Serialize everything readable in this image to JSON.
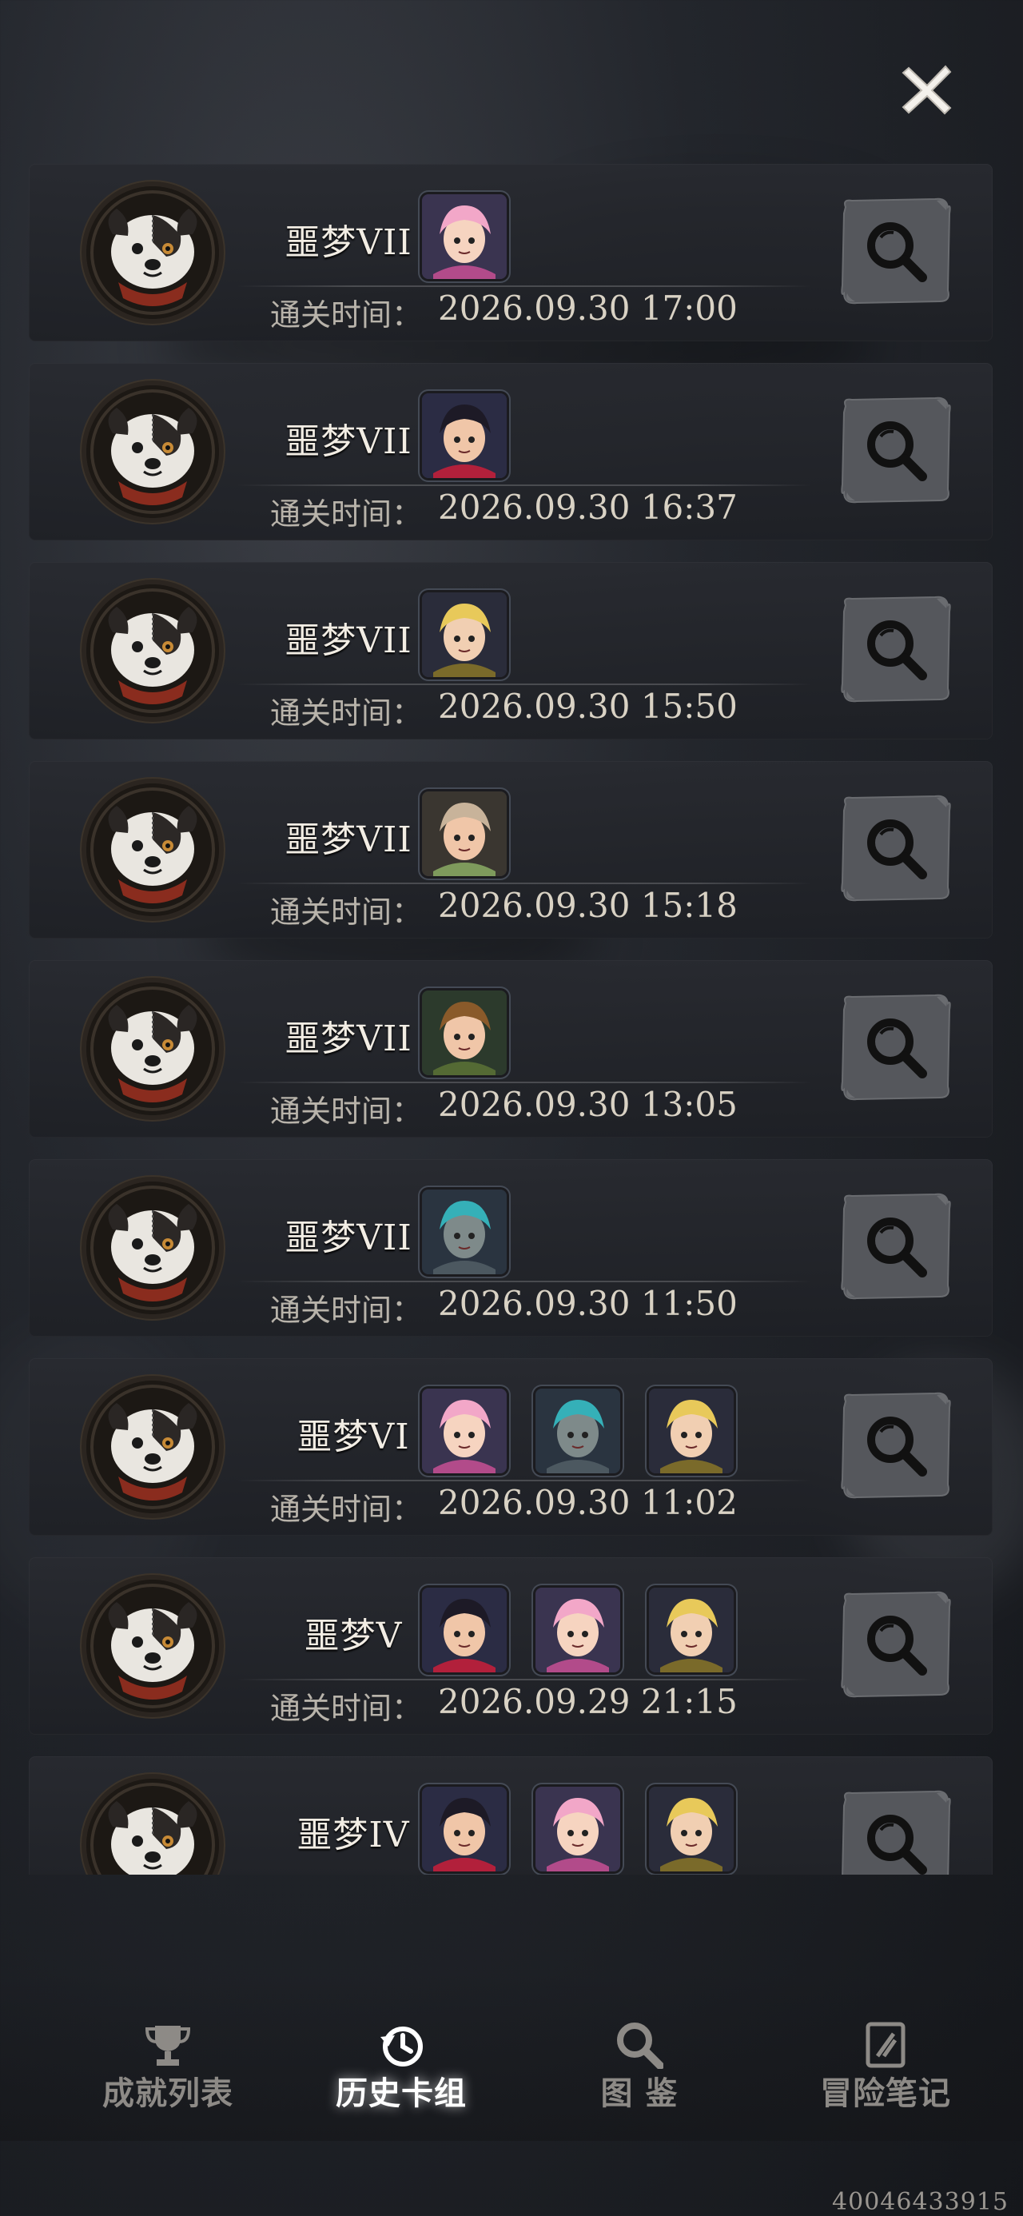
{
  "close_label": "✕",
  "time_label": "通关时间：",
  "records": [
    {
      "stage": "噩梦VII",
      "time": "2026.09.30 17:00",
      "cards": [
        "elf-pink-hair"
      ]
    },
    {
      "stage": "噩梦VII",
      "time": "2026.09.30 16:37",
      "cards": [
        "girl-red-bow"
      ]
    },
    {
      "stage": "噩梦VII",
      "time": "2026.09.30 15:50",
      "cards": [
        "blonde-knight"
      ]
    },
    {
      "stage": "噩梦VII",
      "time": "2026.09.30 15:18",
      "cards": [
        "bear-ears-girl"
      ]
    },
    {
      "stage": "噩梦VII",
      "time": "2026.09.30 13:05",
      "cards": [
        "green-hat-boy"
      ]
    },
    {
      "stage": "噩梦VII",
      "time": "2026.09.30 11:50",
      "cards": [
        "robot-mohawk"
      ]
    },
    {
      "stage": "噩梦VI",
      "time": "2026.09.30 11:02",
      "cards": [
        "elf-pink-hair",
        "robot-mohawk",
        "blonde-knight"
      ]
    },
    {
      "stage": "噩梦V",
      "time": "2026.09.29 21:15",
      "cards": [
        "girl-red-bow",
        "elf-pink-hair",
        "blonde-knight"
      ]
    },
    {
      "stage": "噩梦IV",
      "time": "",
      "cards": [
        "girl-red-bow",
        "elf-pink-hair",
        "blonde-knight"
      ]
    }
  ],
  "tabs": [
    {
      "label": "成就列表",
      "icon": "trophy-icon",
      "active": false
    },
    {
      "label": "历史卡组",
      "icon": "history-icon",
      "active": true
    },
    {
      "label": "图  鉴",
      "icon": "magnifier-icon",
      "active": false
    },
    {
      "label": "冒险笔记",
      "icon": "notebook-icon",
      "active": false
    }
  ],
  "id_number": "40046433915",
  "colors": {
    "accent_active": "#ffffff",
    "tab_inactive": "#8d8a86",
    "row_bg": "#2a2c31"
  }
}
